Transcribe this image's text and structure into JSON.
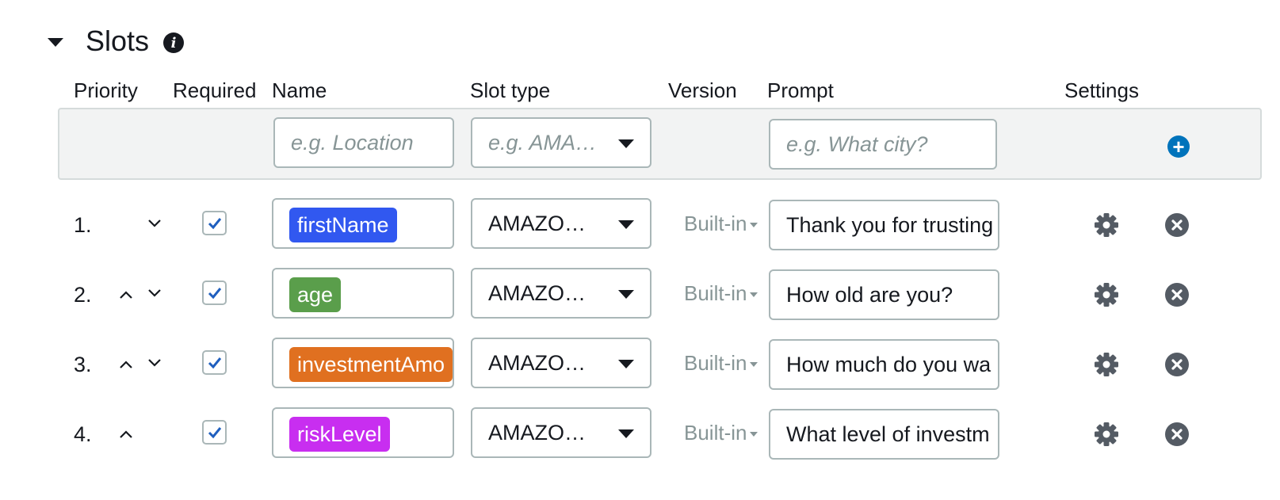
{
  "section": {
    "title": "Slots"
  },
  "columns": {
    "priority": "Priority",
    "required": "Required",
    "name": "Name",
    "slot_type": "Slot type",
    "version": "Version",
    "prompt": "Prompt",
    "settings": "Settings"
  },
  "new_slot": {
    "name_placeholder": "e.g. Location",
    "type_placeholder": "e.g. AMA…",
    "prompt_placeholder": "e.g. What city?"
  },
  "colors": {
    "accent": "#0073bb",
    "checkbox_check": "#1f5fbf"
  },
  "slots": [
    {
      "priority": "1.",
      "required": true,
      "name": "firstName",
      "tag_color": "#3158f0",
      "slot_type": "AMAZO…",
      "version": "Built-in",
      "prompt": "Thank you for trusting",
      "move_up": false,
      "move_down": true
    },
    {
      "priority": "2.",
      "required": true,
      "name": "age",
      "tag_color": "#5a9e4b",
      "slot_type": "AMAZO…",
      "version": "Built-in",
      "prompt": "How old are you?",
      "move_up": true,
      "move_down": true
    },
    {
      "priority": "3.",
      "required": true,
      "name": "investmentAmo",
      "tag_color": "#e07020",
      "slot_type": "AMAZO…",
      "version": "Built-in",
      "prompt": "How much do you wa",
      "move_up": true,
      "move_down": true
    },
    {
      "priority": "4.",
      "required": true,
      "name": "riskLevel",
      "tag_color": "#c82ef0",
      "slot_type": "AMAZO…",
      "version": "Built-in",
      "prompt": "What level of investm",
      "move_up": true,
      "move_down": false
    }
  ]
}
